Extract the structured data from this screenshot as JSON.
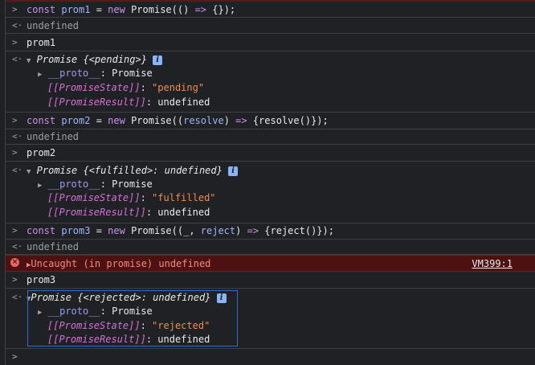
{
  "glyphs": {
    "input_prompt": ">",
    "output_prompt": "<·",
    "expand_open": "▼",
    "expand_closed": "▶",
    "info_badge": "i",
    "error_badge": "×"
  },
  "entries": [
    {
      "input": {
        "kw1": "const",
        "name": "prom1",
        "eq": " = ",
        "kw2": "new",
        "rest": " Promise(() ",
        "arrow": "=>",
        "tail": " {});"
      },
      "output": "undefined"
    },
    {
      "input": "prom1",
      "object": {
        "summary_type": "Promise",
        "summary_state": "{<pending>}",
        "proto_key": "__proto__",
        "proto_val": "Promise",
        "state_key": "[[PromiseState]]",
        "state_val": "\"pending\"",
        "result_key": "[[PromiseResult]]",
        "result_val": "undefined"
      }
    },
    {
      "input": {
        "kw1": "const",
        "name": "prom2",
        "eq": " = ",
        "kw2": "new",
        "rest": " Promise((",
        "param": "resolve",
        "rest2": ") ",
        "arrow": "=>",
        "tail": " {resolve()});"
      },
      "output": "undefined"
    },
    {
      "input": "prom2",
      "object": {
        "summary_type": "Promise",
        "summary_state": "{<fulfilled>: undefined}",
        "proto_key": "__proto__",
        "proto_val": "Promise",
        "state_key": "[[PromiseState]]",
        "state_val": "\"fulfilled\"",
        "result_key": "[[PromiseResult]]",
        "result_val": "undefined"
      }
    },
    {
      "input": {
        "kw1": "const",
        "name": "prom3",
        "eq": " = ",
        "kw2": "new",
        "rest": " Promise((_, ",
        "param": "reject",
        "rest2": ") ",
        "arrow": "=>",
        "tail": " {reject()});"
      },
      "output": "undefined"
    },
    {
      "error": {
        "text": "Uncaught (in promise)",
        "value": "undefined",
        "link": "VM399:1"
      }
    },
    {
      "input": "prom3",
      "object": {
        "summary_type": "Promise",
        "summary_state": "{<rejected>: undefined}",
        "proto_key": "__proto__",
        "proto_val": "Promise",
        "state_key": "[[PromiseState]]",
        "state_val": "\"rejected\"",
        "result_key": "[[PromiseResult]]",
        "result_val": "undefined"
      }
    }
  ],
  "prompt_caret": ">",
  "colors": {
    "background": "#202124",
    "keyword": "#c792ea",
    "variable": "#9fb4ff",
    "string": "#f28b54",
    "internal_property": "#d670d6",
    "error_background": "#4e1111",
    "error_text": "#f28b82",
    "selection_border": "#2f6fd1"
  }
}
